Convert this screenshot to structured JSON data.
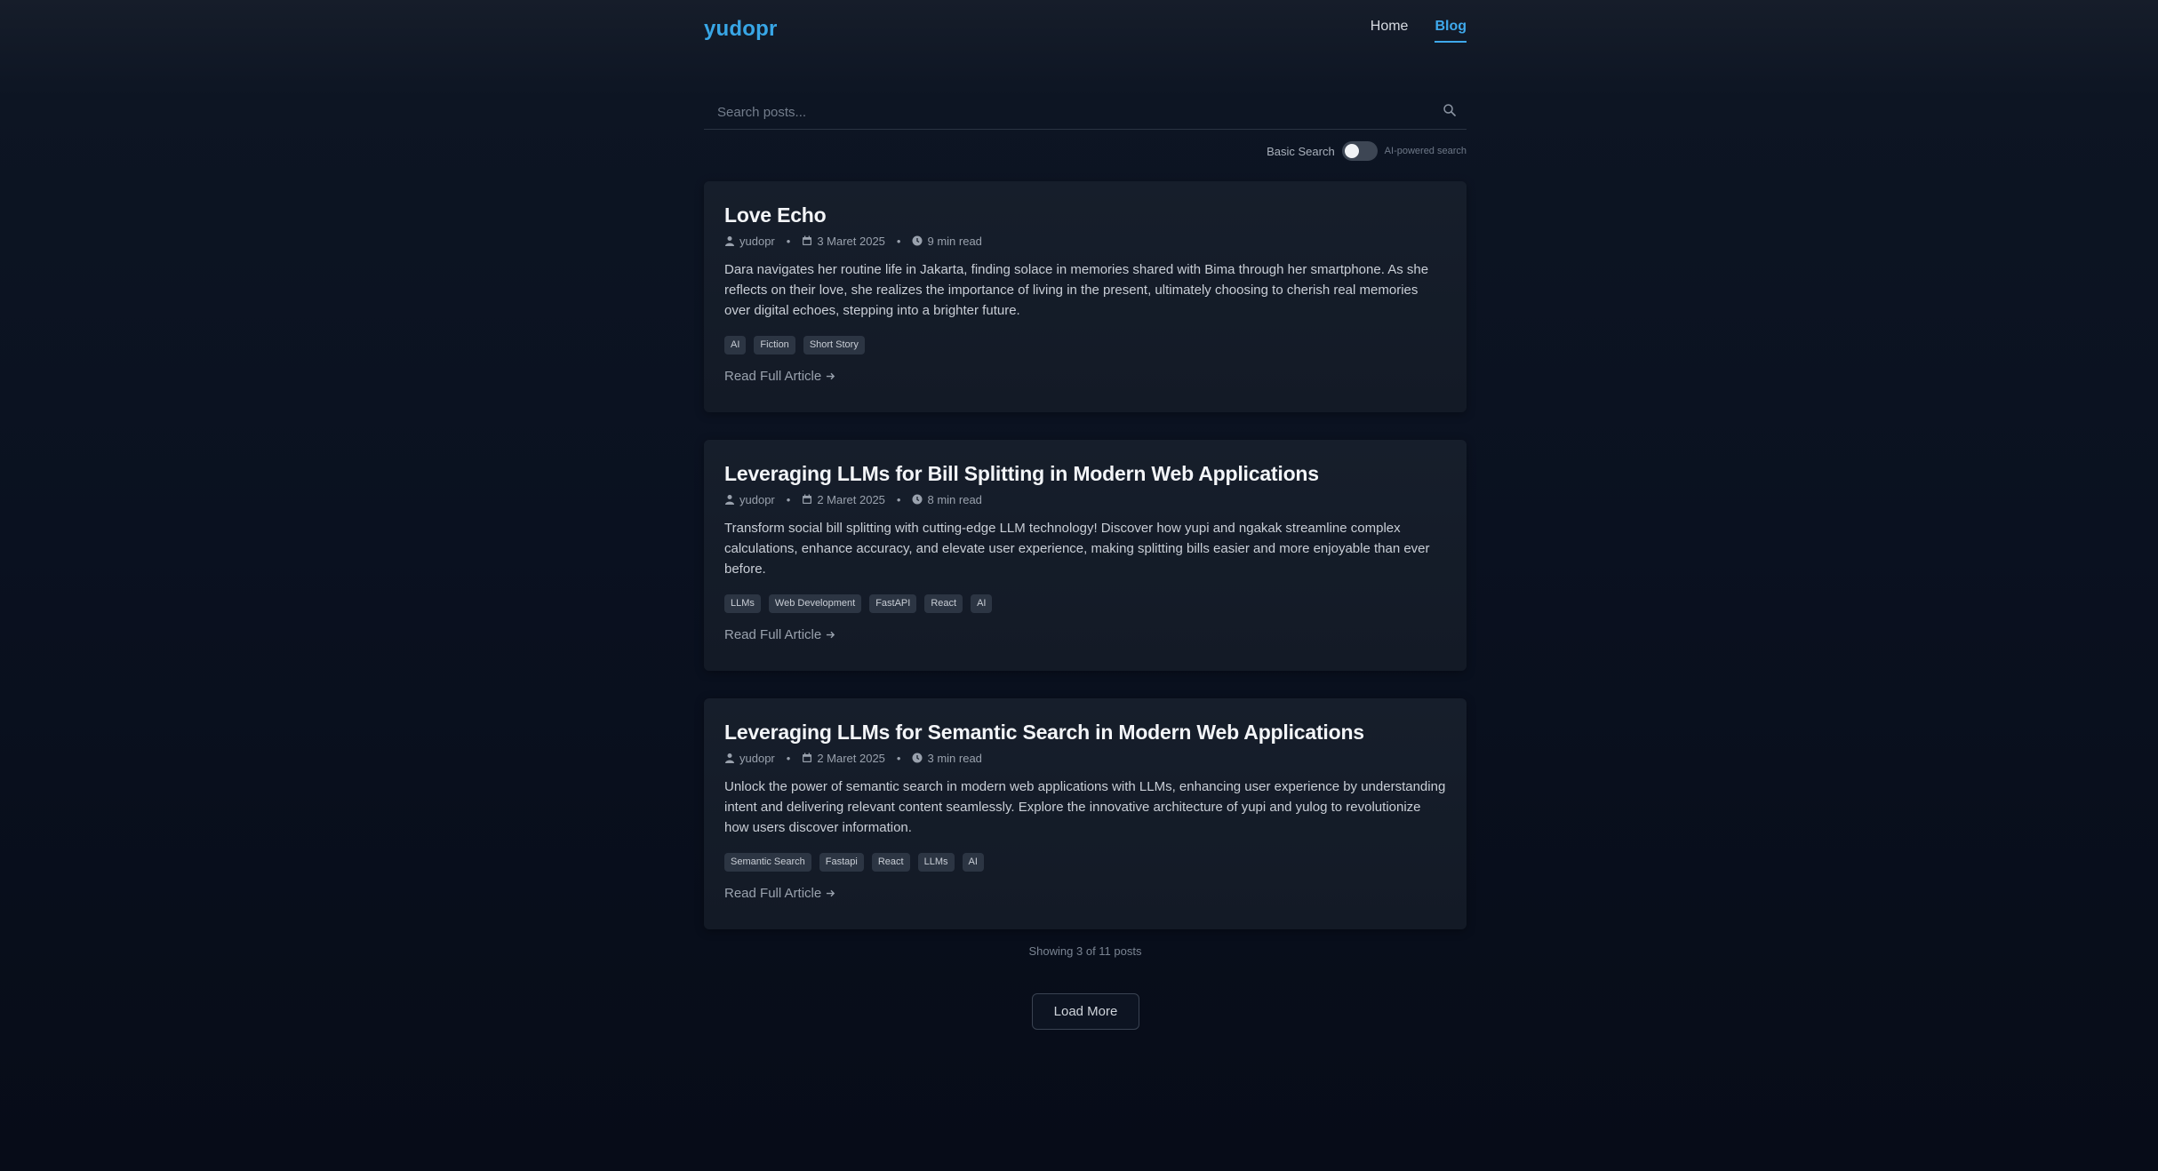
{
  "brand": "yudopr",
  "nav": [
    {
      "label": "Home",
      "active": false
    },
    {
      "label": "Blog",
      "active": true
    }
  ],
  "search": {
    "placeholder": "Search posts...",
    "toggle_label": "Basic Search",
    "toggle_sub": "AI-powered search",
    "toggle_on": false
  },
  "posts": [
    {
      "title": "Love Echo",
      "author": "yudopr",
      "date": "3 Maret 2025",
      "read_time": "9 min read",
      "excerpt": "Dara navigates her routine life in Jakarta, finding solace in memories shared with Bima through her smartphone. As she reflects on their love, she realizes the importance of living in the present, ultimately choosing to cherish real memories over digital echoes, stepping into a brighter future.",
      "tags": [
        "AI",
        "Fiction",
        "Short Story"
      ],
      "read_more": "Read Full Article"
    },
    {
      "title": "Leveraging LLMs for Bill Splitting in Modern Web Applications",
      "author": "yudopr",
      "date": "2 Maret 2025",
      "read_time": "8 min read",
      "excerpt": "Transform social bill splitting with cutting-edge LLM technology! Discover how yupi and ngakak streamline complex calculations, enhance accuracy, and elevate user experience, making splitting bills easier and more enjoyable than ever before.",
      "tags": [
        "LLMs",
        "Web Development",
        "FastAPI",
        "React",
        "AI"
      ],
      "read_more": "Read Full Article"
    },
    {
      "title": "Leveraging LLMs for Semantic Search in Modern Web Applications",
      "author": "yudopr",
      "date": "2 Maret 2025",
      "read_time": "3 min read",
      "excerpt": "Unlock the power of semantic search in modern web applications with LLMs, enhancing user experience by understanding intent and delivering relevant content seamlessly. Explore the innovative architecture of yupi and yulog to revolutionize how users discover information.",
      "tags": [
        "Semantic Search",
        "Fastapi",
        "React",
        "LLMs",
        "AI"
      ],
      "read_more": "Read Full Article"
    }
  ],
  "showing": "Showing 3 of 11 posts",
  "load_more": "Load More",
  "colors": {
    "accent": "#3fa9ec",
    "background": "#0a1120",
    "card": "#141c28",
    "tag": "#2c3543"
  }
}
